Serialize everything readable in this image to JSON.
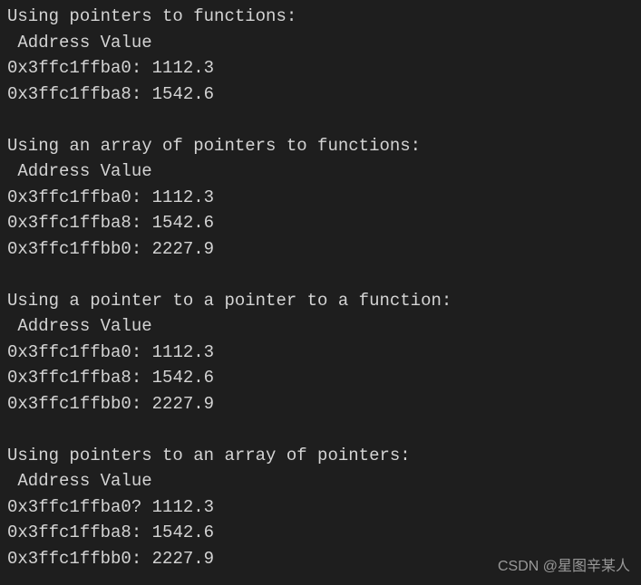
{
  "sections": [
    {
      "title": "Using pointers to functions:",
      "header": " Address Value",
      "rows": [
        {
          "addr": "0x3ffc1ffba0",
          "sep": ":",
          "value": "1112.3"
        },
        {
          "addr": "0x3ffc1ffba8",
          "sep": ":",
          "value": "1542.6"
        }
      ]
    },
    {
      "title": "Using an array of pointers to functions:",
      "header": " Address Value",
      "rows": [
        {
          "addr": "0x3ffc1ffba0",
          "sep": ":",
          "value": "1112.3"
        },
        {
          "addr": "0x3ffc1ffba8",
          "sep": ":",
          "value": "1542.6"
        },
        {
          "addr": "0x3ffc1ffbb0",
          "sep": ":",
          "value": "2227.9"
        }
      ]
    },
    {
      "title": "Using a pointer to a pointer to a function:",
      "header": " Address Value",
      "rows": [
        {
          "addr": "0x3ffc1ffba0",
          "sep": ":",
          "value": "1112.3"
        },
        {
          "addr": "0x3ffc1ffba8",
          "sep": ":",
          "value": "1542.6"
        },
        {
          "addr": "0x3ffc1ffbb0",
          "sep": ":",
          "value": "2227.9"
        }
      ]
    },
    {
      "title": "Using pointers to an array of pointers:",
      "header": " Address Value",
      "rows": [
        {
          "addr": "0x3ffc1ffba0",
          "sep": "?",
          "value": "1112.3"
        },
        {
          "addr": "0x3ffc1ffba8",
          "sep": ":",
          "value": "1542.6"
        },
        {
          "addr": "0x3ffc1ffbb0",
          "sep": ":",
          "value": "2227.9"
        }
      ]
    }
  ],
  "watermark": "CSDN @星图辛某人"
}
